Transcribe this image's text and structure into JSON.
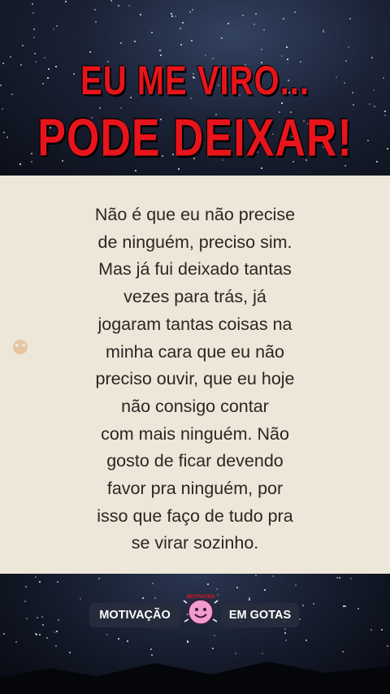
{
  "headline": {
    "line1": "EU ME VIRO...",
    "line2": "PODE DEIXAR!",
    "color": "#e8141b"
  },
  "quote": {
    "lines": [
      "Não é que eu não precise",
      "de ninguém, preciso sim.",
      "Mas já fui deixado tantas",
      "vezes para trás, já",
      "jogaram tantas coisas na",
      "minha cara que eu não",
      "preciso ouvir, que eu hoje",
      "não consigo contar",
      "com mais ninguém. Não",
      "gosto de ficar devendo",
      "favor pra ninguém, por",
      "isso que faço de tudo pra",
      "se virar sozinho."
    ]
  },
  "branding": {
    "left_label": "MOTIVAÇÃO",
    "right_label": "EM GOTAS",
    "logo_text": "MOTIVATED",
    "logo_icon": "pink-smiley-face-icon"
  },
  "colors": {
    "card_background": "#ede7d9",
    "text": "#2a2623",
    "logo_pink": "#f29bd0"
  }
}
